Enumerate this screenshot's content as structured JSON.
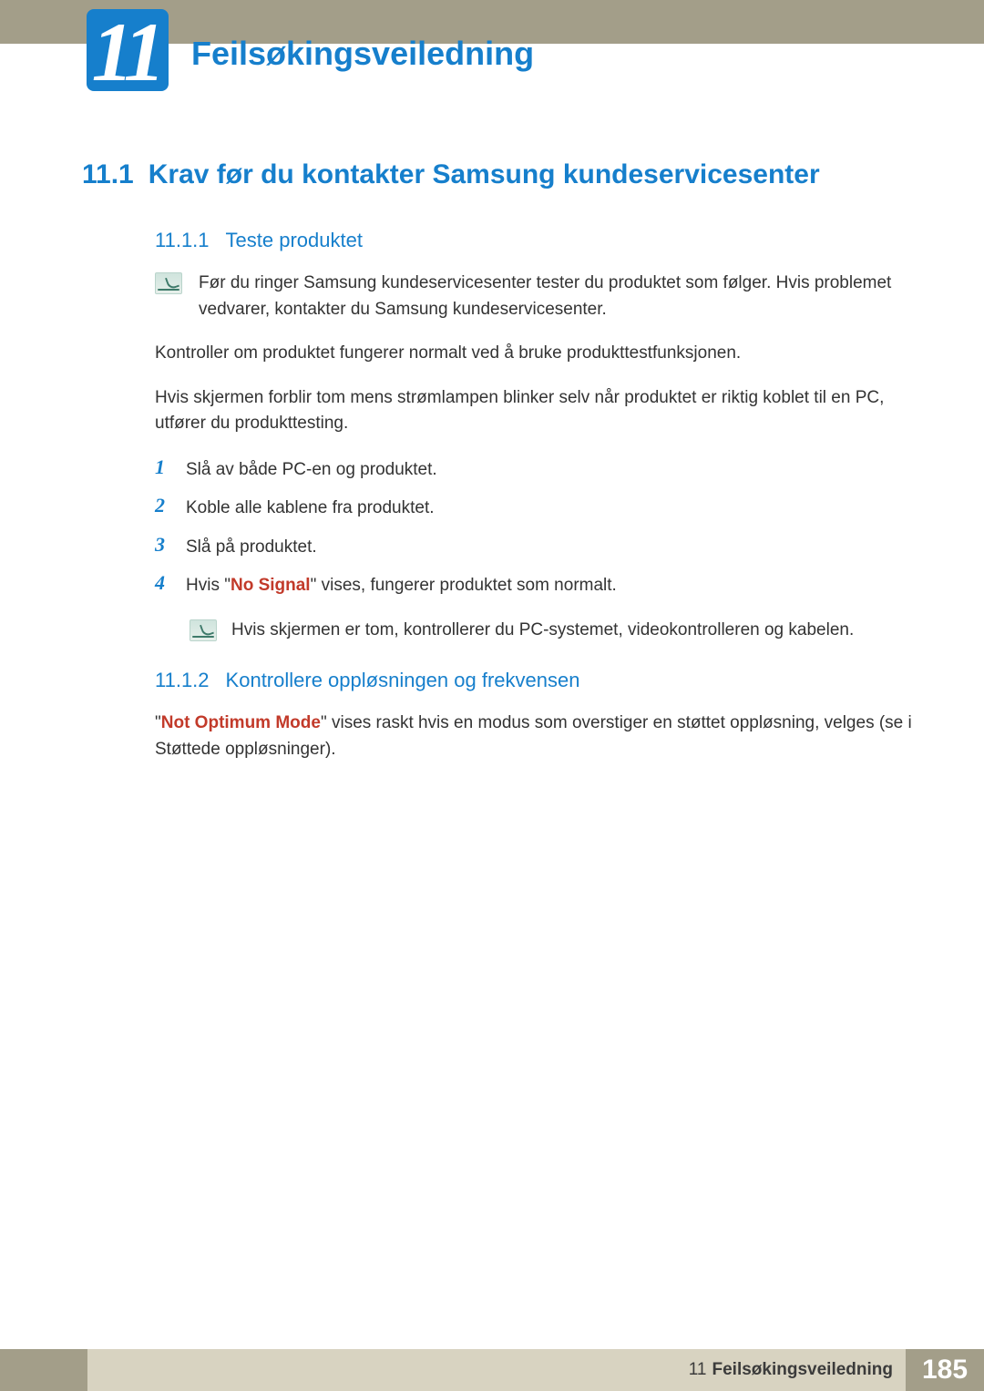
{
  "chapter": {
    "number": "11",
    "title": "Feilsøkingsveiledning"
  },
  "section": {
    "number": "11.1",
    "title": "Krav før du kontakter Samsung kundeservicesenter"
  },
  "sub1": {
    "number": "11.1.1",
    "title": "Teste produktet",
    "note": "Før du ringer Samsung kundeservicesenter tester du produktet som følger. Hvis problemet vedvarer, kontakter du Samsung kundeservicesenter.",
    "p1": "Kontroller om produktet fungerer normalt ved å bruke produkttestfunksjonen.",
    "p2": "Hvis skjermen forblir tom mens strømlampen blinker selv når produktet er riktig koblet til en PC, utfører du produkttesting.",
    "steps": [
      "Slå av både PC-en og produktet.",
      "Koble alle kablene fra produktet.",
      "Slå på produktet."
    ],
    "step4_pre": "Hvis \"",
    "step4_hl": "No Signal",
    "step4_post": "\" vises, fungerer produktet som normalt.",
    "step4_note": "Hvis skjermen er tom, kontrollerer du PC-systemet, videokontrolleren og kabelen."
  },
  "sub2": {
    "number": "11.1.2",
    "title": "Kontrollere oppløsningen og frekvensen",
    "p_pre": "\"",
    "p_hl": "Not Optimum Mode",
    "p_post": "\" vises raskt hvis en modus som overstiger en støttet oppløsning, velges (se i Støttede oppløsninger)."
  },
  "footer": {
    "chapter_num": "11",
    "chapter_title": "Feilsøkingsveiledning",
    "page": "185"
  }
}
